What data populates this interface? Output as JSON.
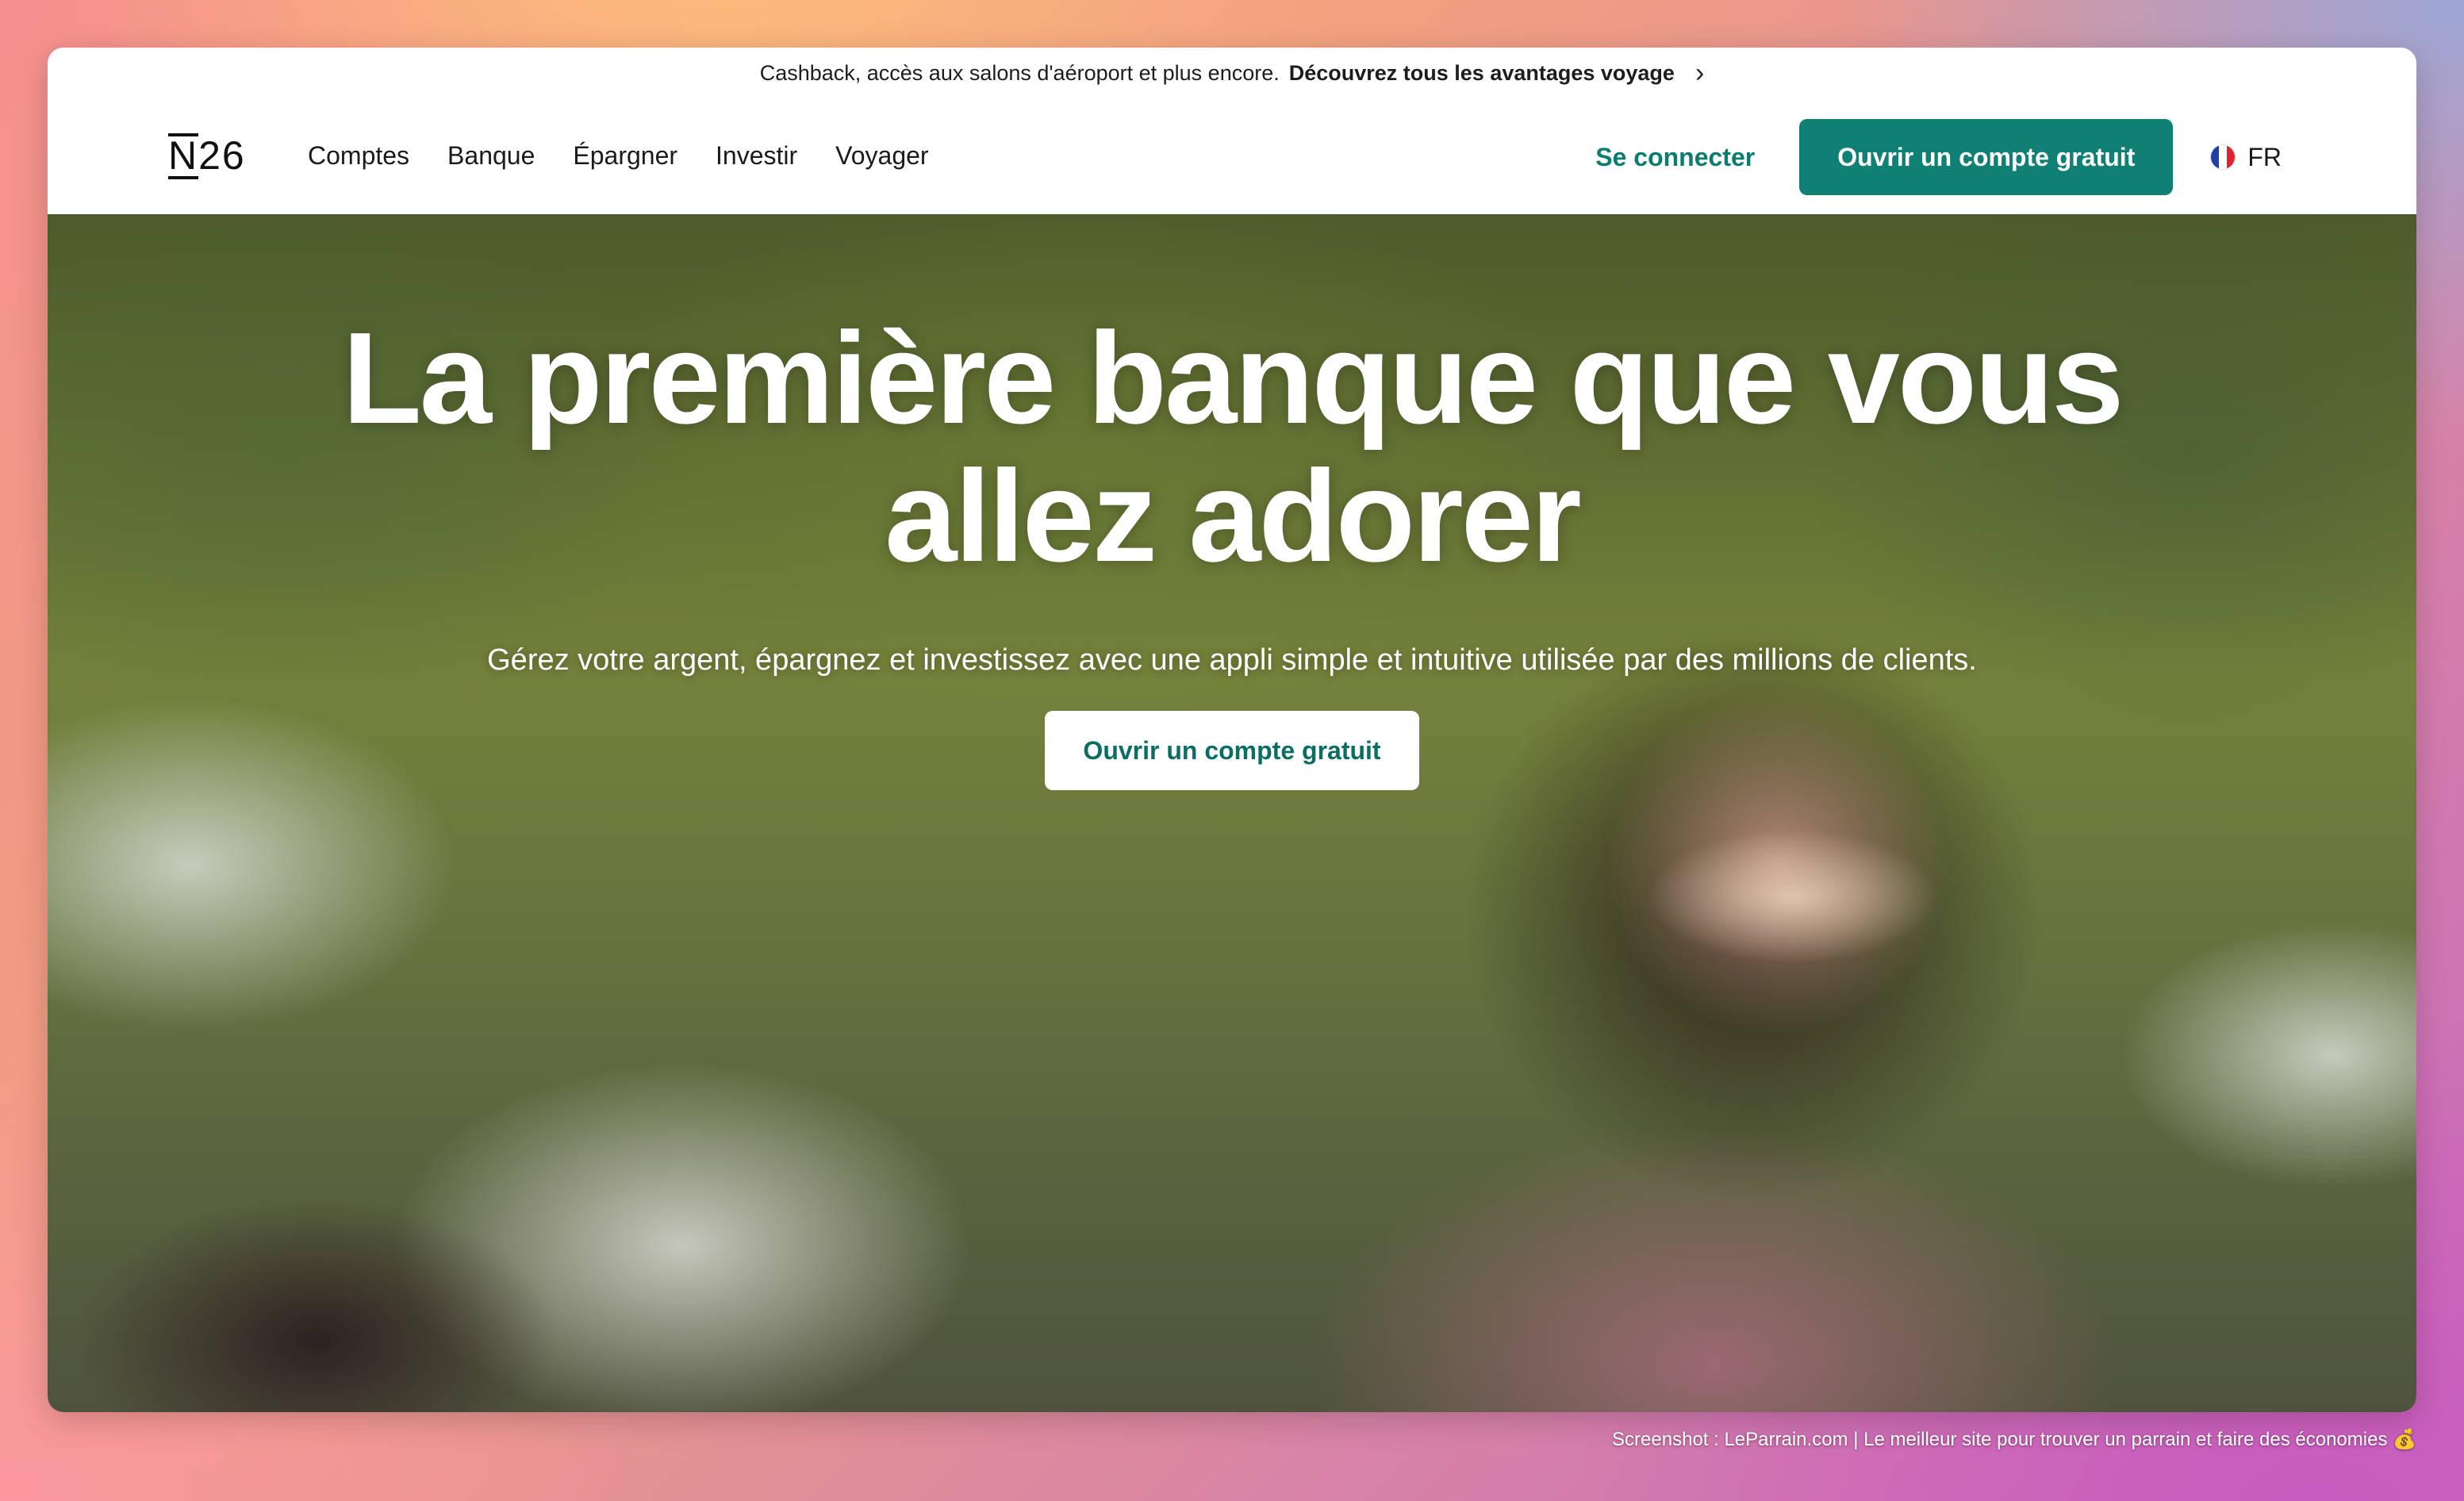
{
  "promo": {
    "text": "Cashback, accès aux salons d'aéroport et plus encore.",
    "link": "Découvrez tous les avantages voyage"
  },
  "nav": {
    "logo": "N26",
    "links": [
      "Comptes",
      "Banque",
      "Épargner",
      "Investir",
      "Voyager"
    ],
    "login": "Se connecter",
    "cta": "Ouvrir un compte gratuit",
    "lang": "FR"
  },
  "hero": {
    "title_line1": "La première banque que vous",
    "title_line2": "allez adorer",
    "subtitle": "Gérez votre argent, épargnez et investissez avec une appli simple et intuitive utilisée par des millions de clients.",
    "cta": "Ouvrir un compte gratuit"
  },
  "footer": {
    "credit": "Screenshot : LeParrain.com | Le meilleur site pour trouver un parrain et faire des économies 💰"
  },
  "colors": {
    "brand_teal": "#0f8073",
    "text_dark": "#1b1b1b"
  }
}
